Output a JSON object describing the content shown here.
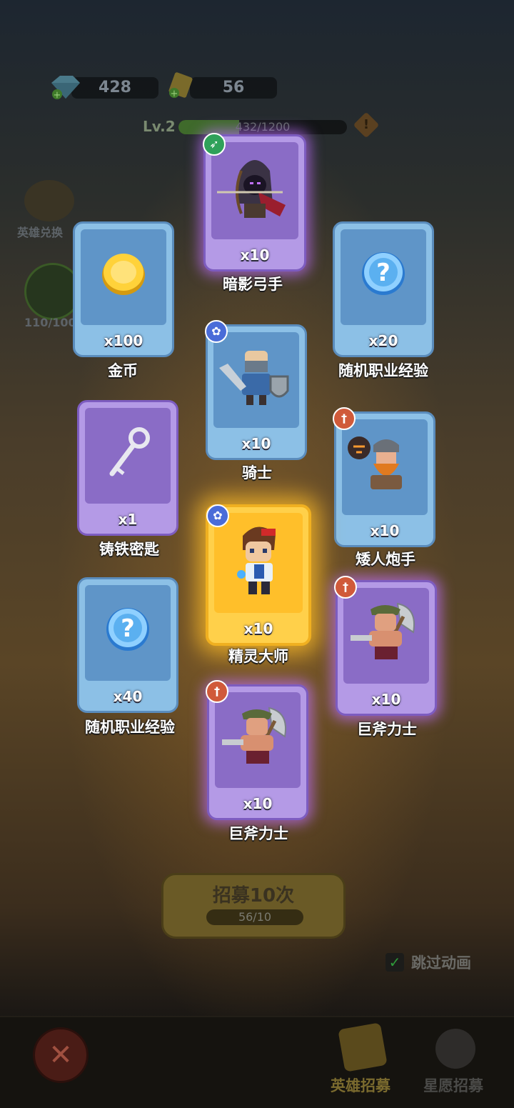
{
  "top": {
    "gems": "428",
    "tickets": "56",
    "level": "Lv.2",
    "xp_text": "432/1200",
    "xp_fraction": 0.36
  },
  "side": {
    "hero_exchange": "英雄兑换",
    "energy_count": "110/100"
  },
  "rewards": [
    {
      "label": "暗影弓手",
      "qty": "x10",
      "rarity": "purple",
      "badge": "bow-class-icon"
    },
    {
      "label": "金币",
      "qty": "x100",
      "rarity": "blue",
      "icon": "gold-coin-icon"
    },
    {
      "label": "随机职业经验",
      "qty": "x20",
      "rarity": "blue",
      "icon": "question-orb-icon"
    },
    {
      "label": "骑士",
      "qty": "x10",
      "rarity": "blue",
      "badge": "paw-class-icon"
    },
    {
      "label": "铸铁密匙",
      "qty": "x1",
      "rarity": "purple",
      "icon": "iron-key-icon"
    },
    {
      "label": "矮人炮手",
      "qty": "x10",
      "rarity": "blue",
      "badge": "sword-class-icon"
    },
    {
      "label": "精灵大师",
      "qty": "x10",
      "rarity": "gold",
      "badge": "paw-class-icon"
    },
    {
      "label": "随机职业经验",
      "qty": "x40",
      "rarity": "blue",
      "icon": "question-orb-icon"
    },
    {
      "label": "巨斧力士",
      "qty": "x10",
      "rarity": "purple",
      "badge": "sword-class-icon"
    },
    {
      "label": "巨斧力士",
      "qty": "x10",
      "rarity": "purple",
      "badge": "sword-class-icon"
    }
  ],
  "recruit": {
    "title": "招募10次",
    "cost": "56/10"
  },
  "skip_animation": "跳过动画",
  "nav": {
    "hero_recruit": "英雄招募",
    "star_recruit": "星愿招募"
  },
  "colors": {
    "blue_card": "#8cc0e6",
    "purple_card": "#b49ae6",
    "gold_card": "#ffd04a"
  }
}
